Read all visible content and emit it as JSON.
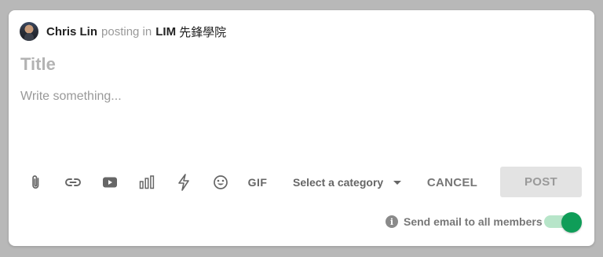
{
  "composer": {
    "author_name": "Chris Lin",
    "posting_in_text": "posting in",
    "group_name": "LIM",
    "group_name_cjk": "先鋒學院",
    "title_placeholder": "Title",
    "body_placeholder": "Write something..."
  },
  "toolbar": {
    "icons": [
      "attachment-icon",
      "link-icon",
      "youtube-icon",
      "poll-icon",
      "lightning-icon",
      "emoji-icon",
      "gif-icon"
    ],
    "gif_label": "GIF",
    "category_placeholder": "Select a category",
    "cancel_label": "CANCEL",
    "post_label": "POST"
  },
  "footer": {
    "info_glyph": "i",
    "send_email_label": "Send email to all members",
    "send_email_enabled": true
  },
  "colors": {
    "accent": "#0f9d58",
    "accent_light": "#b7e5c9",
    "post_disabled_bg": "#e3e3e3",
    "page_bg": "#b8b8b8"
  }
}
